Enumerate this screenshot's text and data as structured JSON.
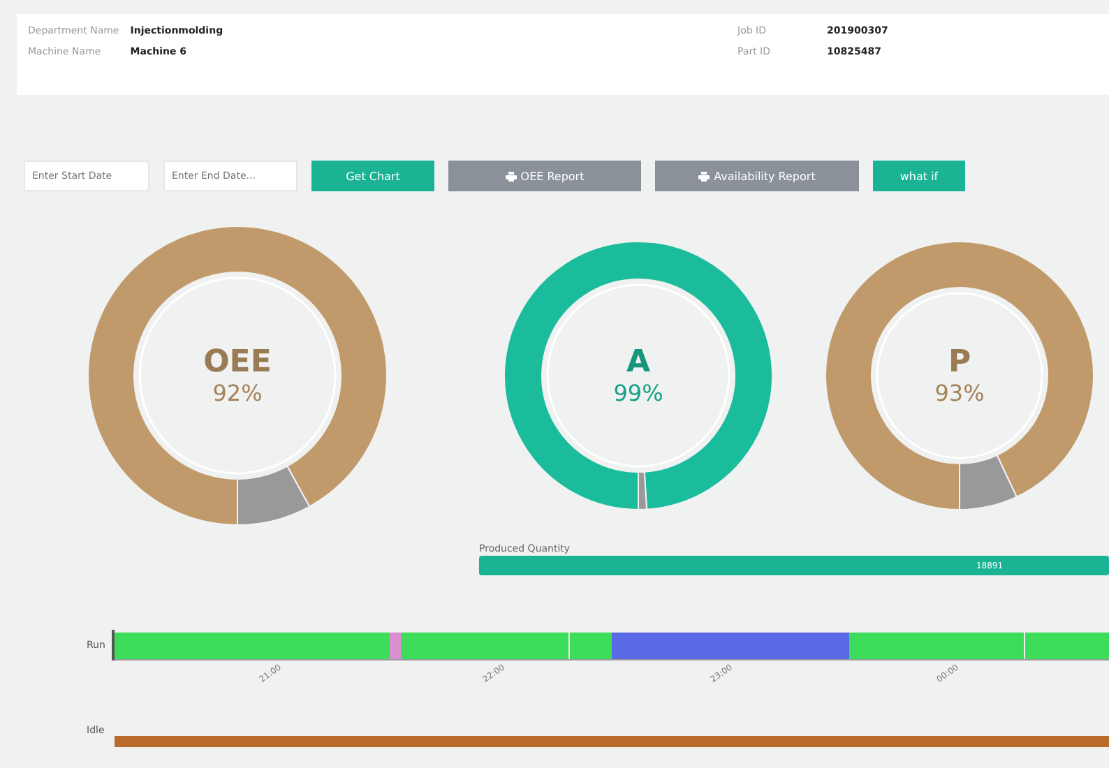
{
  "header": {
    "fields": [
      {
        "label": "Department Name",
        "value": "Injectionmolding"
      },
      {
        "label": "Machine Name",
        "value": "Machine 6"
      },
      {
        "label": "Job ID",
        "value": "201900307"
      },
      {
        "label": "Part ID",
        "value": "10825487"
      }
    ]
  },
  "toolbar": {
    "start_date": {
      "placeholder": "Enter Start Date"
    },
    "end_date": {
      "placeholder": "Enter End Date..."
    },
    "buttons": [
      {
        "label": "Get Chart",
        "kind": "primary"
      },
      {
        "label": "OEE Report",
        "kind": "print"
      },
      {
        "label": "Availability Report",
        "kind": "print"
      },
      {
        "label": "what if",
        "kind": "primary"
      }
    ]
  },
  "gauges": [
    {
      "title": "OEE",
      "reading": "92%",
      "color": "#c19a6b",
      "chart_data": {
        "type": "donut",
        "values": [
          92,
          8
        ]
      }
    },
    {
      "title": "A",
      "reading": "99%",
      "color": "#1abc9c",
      "chart_data": {
        "type": "donut",
        "values": [
          99,
          1
        ]
      }
    },
    {
      "title": "P",
      "reading": "93%",
      "color": "#c19a6b",
      "chart_data": {
        "type": "donut",
        "values": [
          93,
          7
        ]
      }
    }
  ],
  "produced": {
    "label": "Produced Quantity",
    "value": "18891"
  },
  "timeline": {
    "row_label": "Run",
    "ticks": [
      "21:00",
      "22:00",
      "23:00",
      "00:00"
    ]
  },
  "second_row": {
    "row_label": "Idle"
  }
}
